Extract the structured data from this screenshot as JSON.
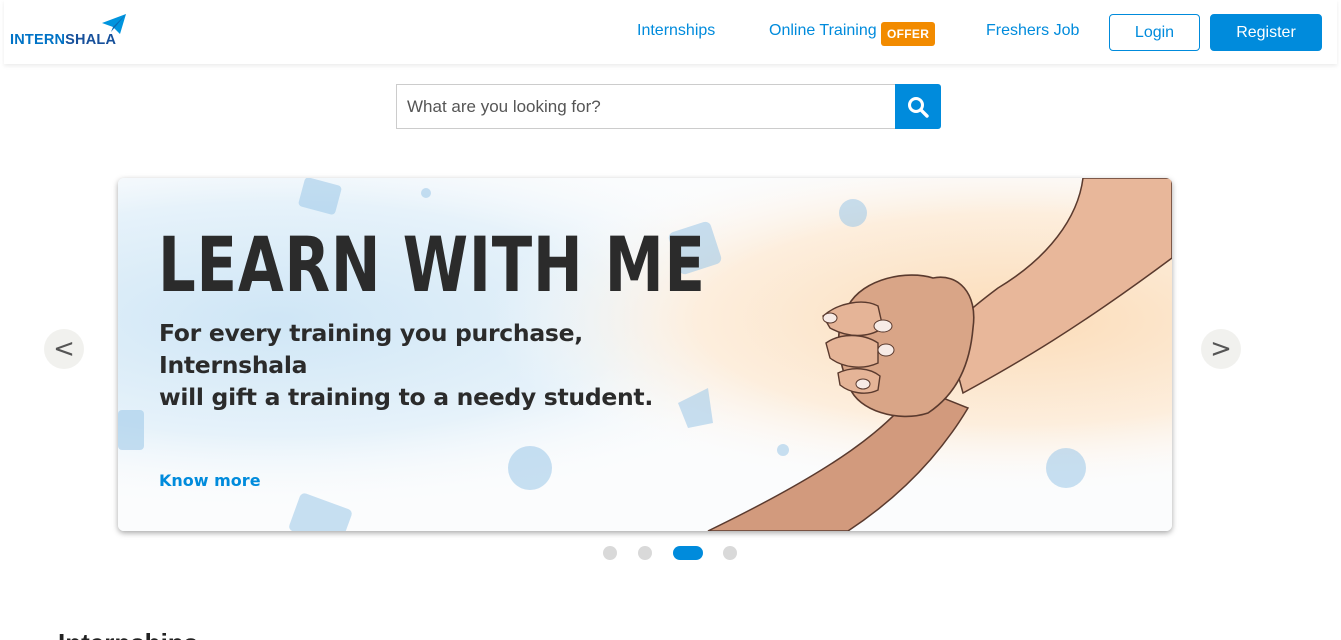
{
  "brand": {
    "part1": "INTERN",
    "part2": "SHALA"
  },
  "nav": {
    "internships": "Internships",
    "online_training": "Online Training",
    "offer_badge": "OFFER",
    "freshers_job": "Freshers Job",
    "login": "Login",
    "register": "Register"
  },
  "search": {
    "placeholder": "What are you looking for?",
    "value": ""
  },
  "carousel": {
    "prev": "<",
    "next": ">",
    "slide": {
      "title": "LEARN WITH ME",
      "subtitle_line1": "For every training you purchase, Internshala",
      "subtitle_line2": "will gift a training to a needy student.",
      "cta": "Know more"
    },
    "dots": 4,
    "active_dot": 3
  },
  "section": {
    "heading": "Internships"
  },
  "colors": {
    "accent": "#008bdc",
    "offer": "#f28b00",
    "logo_dark": "#16509b"
  }
}
